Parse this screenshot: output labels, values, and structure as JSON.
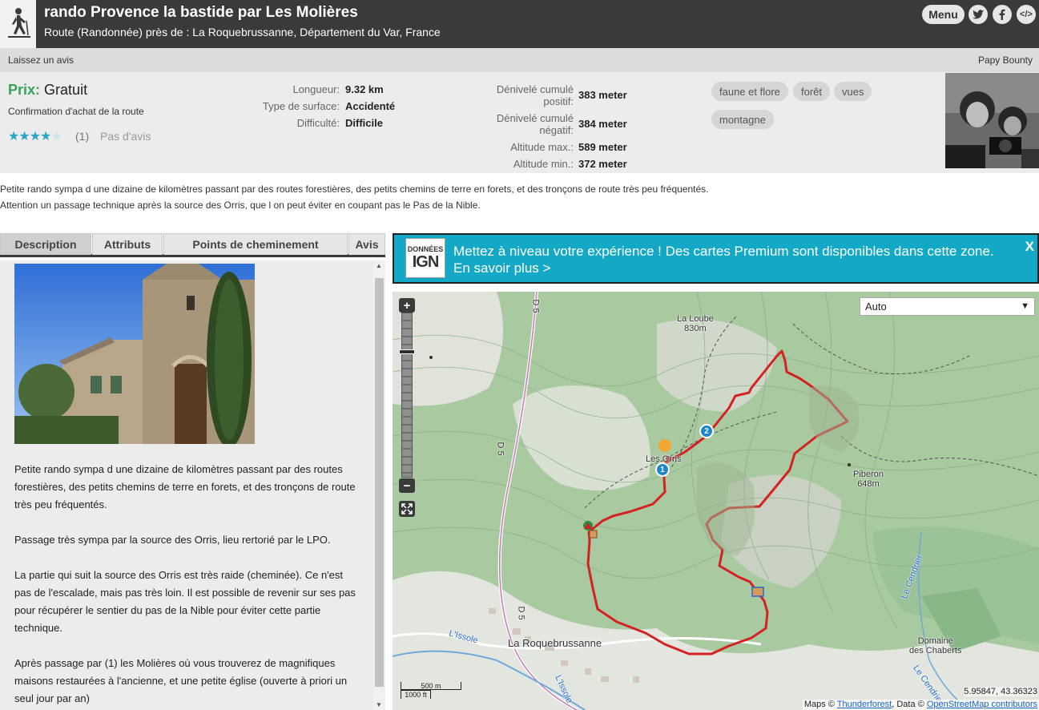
{
  "header": {
    "title": "rando Provence la bastide par Les Molières",
    "subtitle": "Route (Randonnée) près de : La Roquebrussanne, Département du Var, France",
    "menu_label": "Menu",
    "code_label": "</>"
  },
  "subbar": {
    "left": "Laissez un avis",
    "right": "Papy Bounty"
  },
  "info": {
    "price_label": "Prix:",
    "price_value": "Gratuit",
    "purchase_confirmation": "Confirmation d'achat de la route",
    "rating_stars": 4,
    "rating_max": 5,
    "rating_count": "(1)",
    "no_review": "Pas d'avis",
    "length_label": "Longueur:",
    "length_value": "9.32 km",
    "surface_label": "Type de surface:",
    "surface_value": "Accidenté",
    "difficulty_label": "Difficulté:",
    "difficulty_value": "Difficile",
    "elev_gain_label_1": "Dénivelé cumulé",
    "elev_gain_label_2": "positif:",
    "elev_gain_value": "383 meter",
    "elev_loss_label_1": "Dénivelé cumulé",
    "elev_loss_label_2": "négatif:",
    "elev_loss_value": "384 meter",
    "alt_max_label": "Altitude max.:",
    "alt_max_value": "589 meter",
    "alt_min_label": "Altitude min.:",
    "alt_min_value": "372 meter",
    "tags": [
      "faune et flore",
      "forêt",
      "vues",
      "montagne"
    ]
  },
  "summary": {
    "line1": "Petite rando sympa d une dizaine de kilomètres passant par des routes forestières, des petits chemins de terre en forets, et des tronçons de route très peu fréquentés.",
    "line2": "Attention un passage technique après la source des Orris, que l on peut éviter en coupant pas le Pas de la Nible."
  },
  "tabs": [
    "Description",
    "Attributs",
    "Points de cheminement",
    "Avis"
  ],
  "description": {
    "p1_l1": "Petite rando sympa d une  dizaine de kilomètres passant par des routes",
    "p1_l2": "forestières, des petits chemins de terre en forets, et des tronçons de route",
    "p1_l3": "très peu fréquentés.",
    "p2_l1": "Passage très sympa par la source des Orris, lieu rertorié par le LPO.",
    "p3_l1": "La partie qui suit la source des Orris est très raide (cheminée). Ce n'est",
    "p3_l2": "pas de l'escalade, mais pas très loin. Il est possible de revenir sur ses pas",
    "p3_l3": "pour récupérer le sentier du pas de la Nible pour éviter cette partie",
    "p3_l4": "technique.",
    "p4_l1": "Après passage par (1) les Molières où vous trouverez de magnifiques",
    "p4_l2": "maisons restaurées à l'ancienne, et une petite église (ouverte à priori un",
    "p4_l3": "seul jour par an)"
  },
  "ign_banner": {
    "logo_top": "DONNÉES",
    "logo_main": "IGN",
    "text": "Mettez à niveau votre expérience ! Des cartes Premium sont disponibles dans cette zone. En savoir plus >",
    "close": "X"
  },
  "map": {
    "layer_select": "Auto",
    "labels": {
      "loube_name": "La Loube",
      "loube_alt": "830m",
      "piberon_name": "Piberon",
      "piberon_alt": "648m",
      "orris": "Les Orris",
      "roquebrussanne": "La Roquebrussanne",
      "issole": "L'Issole",
      "issole2": "L'Issole",
      "cendrier": "Le Cendrier",
      "cendrier2": "Le Cendrier",
      "chaberts_1": "Domaine",
      "chaberts_2": "des Chaberts",
      "road_d5_a": "D 5",
      "road_d5_b": "D 5",
      "road_d5_c": "D 5"
    },
    "markers": [
      "1",
      "2"
    ],
    "scale_metric": "500 m",
    "scale_imperial": "1000 ft",
    "coordinates": "5.95847, 43.36323",
    "attribution_prefix": "Maps ©",
    "attribution_thunderforest": "Thunderforest",
    "attribution_mid": ", Data ©",
    "attribution_osm": "OpenStreetMap contributors",
    "zoom_in": "+",
    "zoom_out": "−",
    "route_color": "#d42222"
  },
  "colors": {
    "header_bg": "#3a3a3a",
    "price_green": "#39a35a",
    "banner_bg": "#13a9c6",
    "star_blue": "#2aa6c7"
  }
}
